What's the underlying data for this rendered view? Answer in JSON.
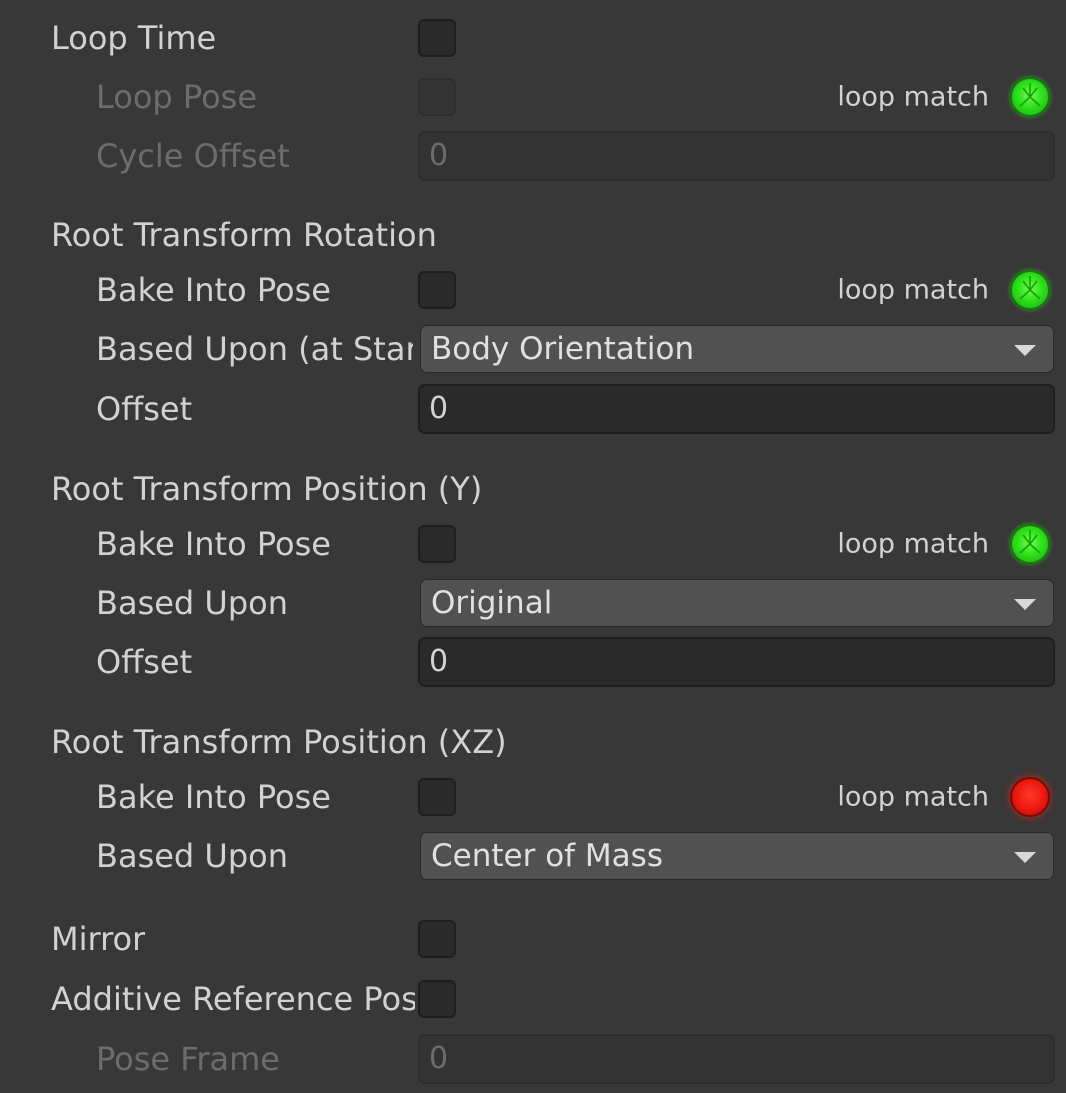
{
  "loop_time": {
    "label": "Loop Time"
  },
  "loop_pose": {
    "label": "Loop Pose",
    "loop_match_label": "loop match",
    "loop_match_status": "green"
  },
  "cycle_offset": {
    "label": "Cycle Offset",
    "value": "0"
  },
  "root_rotation": {
    "header": "Root Transform Rotation",
    "bake_label": "Bake Into Pose",
    "loop_match_label": "loop match",
    "loop_match_status": "green",
    "based_upon_label": "Based Upon (at Start)",
    "based_upon_value": "Body Orientation",
    "offset_label": "Offset",
    "offset_value": "0"
  },
  "root_position_y": {
    "header": "Root Transform Position (Y)",
    "bake_label": "Bake Into Pose",
    "loop_match_label": "loop match",
    "loop_match_status": "green",
    "based_upon_label": "Based Upon",
    "based_upon_value": "Original",
    "offset_label": "Offset",
    "offset_value": "0"
  },
  "root_position_xz": {
    "header": "Root Transform Position (XZ)",
    "bake_label": "Bake Into Pose",
    "loop_match_label": "loop match",
    "loop_match_status": "red",
    "based_upon_label": "Based Upon",
    "based_upon_value": "Center of Mass"
  },
  "mirror": {
    "label": "Mirror"
  },
  "additive_reference_pose": {
    "label": "Additive Reference Pose"
  },
  "pose_frame": {
    "label": "Pose Frame",
    "value": "0"
  },
  "colors": {
    "background": "#383838",
    "field": "#2a2a2a",
    "dropdown": "#515151",
    "loop_match_ok": "#2fe21c",
    "loop_match_fail": "#ee1a10"
  }
}
